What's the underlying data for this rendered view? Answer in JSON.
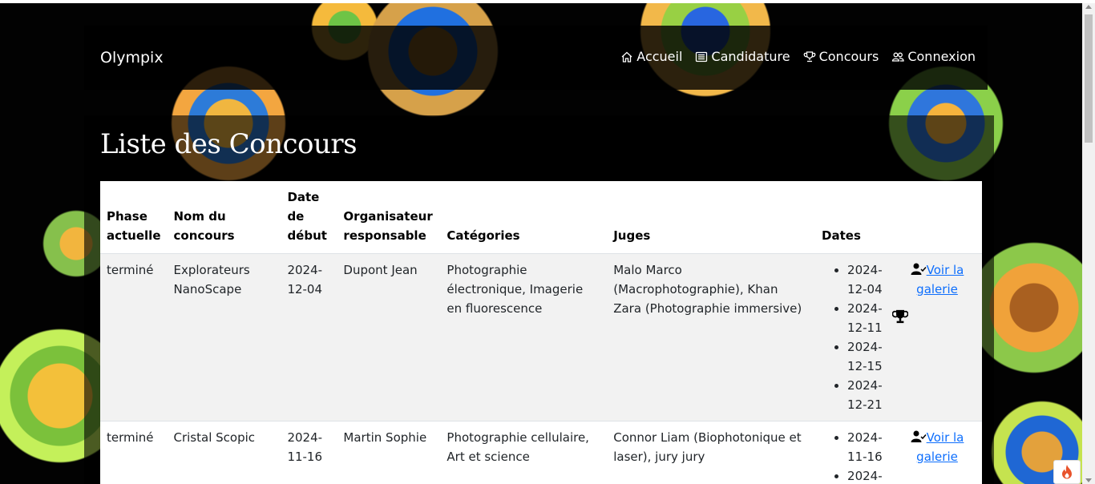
{
  "brand": "Olympix",
  "nav": [
    {
      "label": "Accueil",
      "icon": "home-icon"
    },
    {
      "label": "Candidature",
      "icon": "newspaper-icon"
    },
    {
      "label": "Concours",
      "icon": "trophy-icon"
    },
    {
      "label": "Connexion",
      "icon": "people-icon"
    }
  ],
  "page_title": "Liste des Concours",
  "table": {
    "headers": {
      "phase_l1": "Phase",
      "phase_l2": "actuelle",
      "nom_l1": "Nom du",
      "nom_l2": "concours",
      "date_l1": "Date",
      "date_l2": "de",
      "date_l3": "début",
      "org_l1": "Organisateur",
      "org_l2": "responsable",
      "categories": "Catégories",
      "juges": "Juges",
      "dates": "Dates"
    },
    "rows": [
      {
        "phase": "terminé",
        "nom": "Explorateurs NanoScape",
        "date_debut": "2024-12-04",
        "organisateur": "Dupont Jean",
        "categories": "Photographie électronique, Imagerie en fluorescence",
        "juges": "Malo Marco (Macrophotographie), Khan Zara (Photographie immersive)",
        "dates": [
          "2024-12-04",
          "2024-12-11",
          "2024-12-15",
          "2024-12-21"
        ],
        "gallery_link": "Voir la galerie"
      },
      {
        "phase": "terminé",
        "nom": "Cristal Scopic",
        "date_debut": "2024-11-16",
        "organisateur": "Martin Sophie",
        "categories": "Photographie cellulaire, Art et science",
        "juges": "Connor Liam (Biophotonique et laser), jury jury",
        "dates": [
          "2024-11-16",
          "2024-"
        ],
        "gallery_link": "Voir la galerie"
      }
    ]
  }
}
